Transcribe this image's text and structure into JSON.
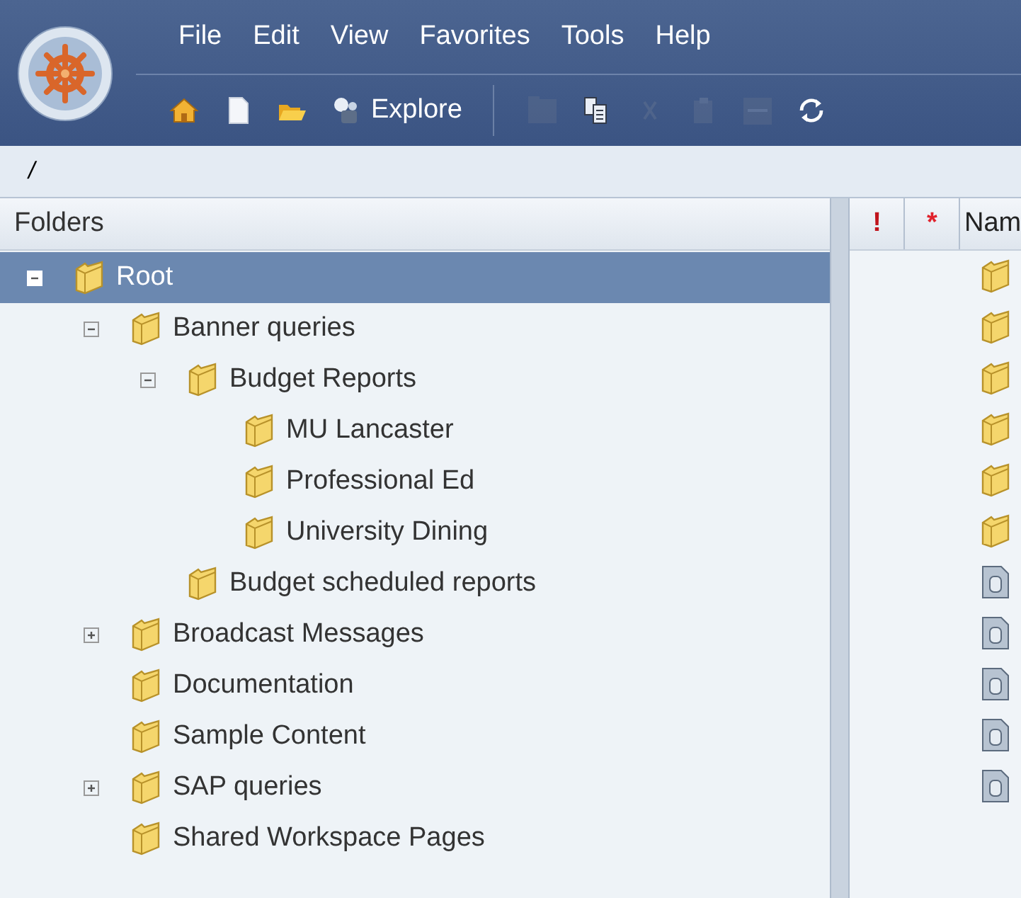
{
  "menu": [
    {
      "label": "File"
    },
    {
      "label": "Edit"
    },
    {
      "label": "View"
    },
    {
      "label": "Favorites"
    },
    {
      "label": "Tools"
    },
    {
      "label": "Help"
    }
  ],
  "toolbar": [
    {
      "kind": "home",
      "disabled": false
    },
    {
      "kind": "new-document",
      "disabled": false
    },
    {
      "kind": "open-folder",
      "disabled": false
    },
    {
      "kind": "explore",
      "label": "Explore",
      "disabled": false
    },
    {
      "kind": "separator"
    },
    {
      "kind": "folder",
      "disabled": true
    },
    {
      "kind": "copy",
      "disabled": false
    },
    {
      "kind": "cut",
      "disabled": true
    },
    {
      "kind": "paste",
      "disabled": true
    },
    {
      "kind": "tray",
      "disabled": true
    },
    {
      "kind": "refresh",
      "disabled": false
    }
  ],
  "path": "/",
  "folders": {
    "title": "Folders",
    "tree": [
      {
        "label": "Root",
        "selected": true,
        "expanded": true,
        "children": [
          {
            "label": "Banner queries",
            "selected": false,
            "expanded": true,
            "children": [
              {
                "label": "Budget Reports",
                "selected": false,
                "expanded": true,
                "children": [
                  {
                    "label": "MU Lancaster",
                    "selected": false
                  },
                  {
                    "label": "Professional Ed",
                    "selected": false
                  },
                  {
                    "label": "University Dining",
                    "selected": false
                  }
                ]
              },
              {
                "label": "Budget scheduled reports",
                "selected": false
              }
            ]
          },
          {
            "label": "Broadcast Messages",
            "selected": false,
            "expanded": false
          },
          {
            "label": "Documentation",
            "selected": false
          },
          {
            "label": "Sample Content",
            "selected": false
          },
          {
            "label": "SAP queries",
            "selected": false,
            "expanded": false
          },
          {
            "label": "Shared Workspace Pages",
            "selected": false
          }
        ]
      }
    ]
  },
  "list": {
    "columns": [
      "!",
      "*",
      "Nam"
    ],
    "rows": [
      {
        "kind": "folder"
      },
      {
        "kind": "folder"
      },
      {
        "kind": "folder"
      },
      {
        "kind": "folder"
      },
      {
        "kind": "folder"
      },
      {
        "kind": "folder"
      },
      {
        "kind": "document"
      },
      {
        "kind": "document"
      },
      {
        "kind": "document"
      },
      {
        "kind": "document"
      },
      {
        "kind": "document"
      }
    ]
  }
}
